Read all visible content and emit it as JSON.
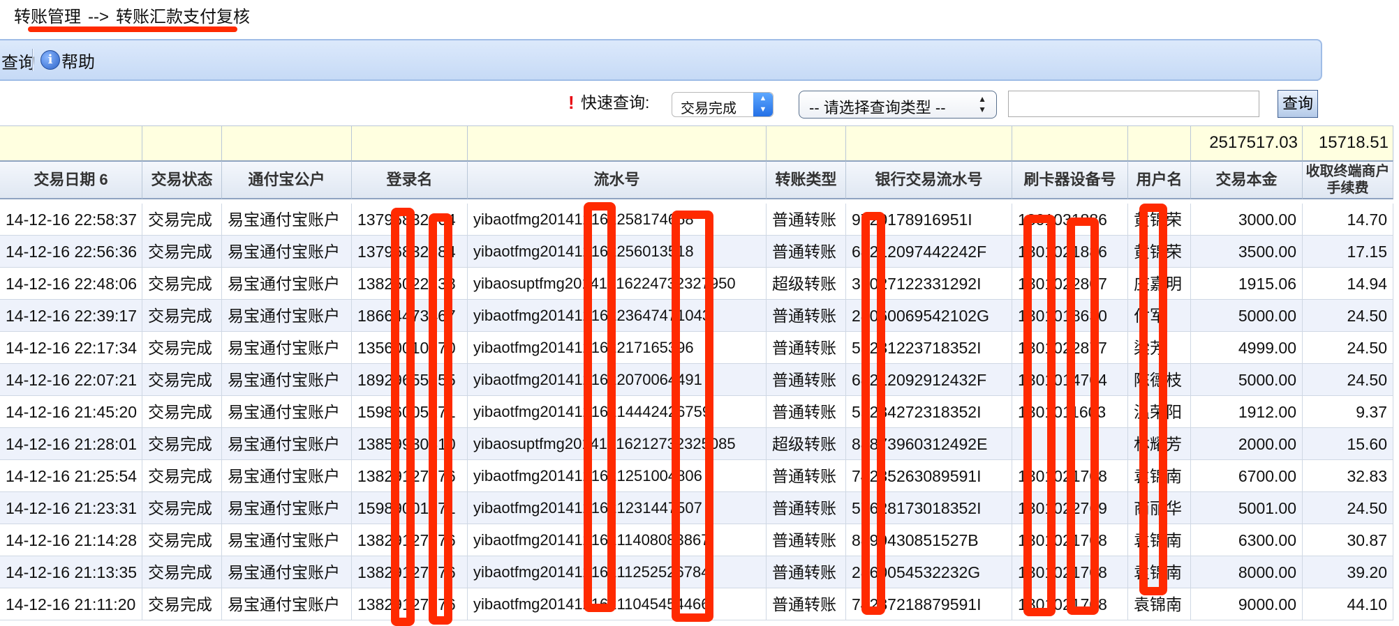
{
  "breadcrumb": {
    "parent": "转账管理",
    "separator": "-->",
    "current": "转账汇款支付复核"
  },
  "toolbar": {
    "query_label": "查询",
    "help_label": "帮助"
  },
  "quick_search": {
    "label": "快速查询:",
    "status_value": "交易完成",
    "type_placeholder": "-- 请选择查询类型 --",
    "input_value": "",
    "button_label": "查询"
  },
  "summary": {
    "principal_total": "2517517.03",
    "fee_total": "15718.51"
  },
  "table": {
    "headers": [
      "交易日期 6",
      "交易状态",
      "通付宝公户",
      "登录名",
      "流水号",
      "转账类型",
      "银行交易流水号",
      "刷卡器设备号",
      "用户名",
      "交易本金",
      "收取终端商户手续费"
    ],
    "rows": [
      [
        "14-12-16 22:58:37",
        "交易完成",
        "易宝通付宝账户",
        "13796832064",
        "yibaotfmg201412162258174658",
        "普通转账",
        "9720178916951I",
        "1301031886",
        "黄锦荣",
        "3000.00",
        "14.70"
      ],
      [
        "14-12-16 22:56:36",
        "交易完成",
        "易宝通付宝账户",
        "13796832384",
        "yibaotfmg201412162256013518",
        "普通转账",
        "6821209744224​2F",
        "1301021886",
        "黄锦荣",
        "3500.00",
        "17.15"
      ],
      [
        "14-12-16 22:48:06",
        "交易完成",
        "易宝通付宝账户",
        "13825022138",
        "yibaosuptfmg201412162247323​27950",
        "超级转账",
        "31027122331292I",
        "1301022807",
        "庄嘉明",
        "1915.06",
        "14.94"
      ],
      [
        "14-12-16 22:39:17",
        "交易完成",
        "易宝通付宝账户",
        "18664473467",
        "yibaotfmg201412162236474710​43",
        "普通转账",
        "28060069542102G",
        "1301018630",
        "付军",
        "5000.00",
        "24.50"
      ],
      [
        "14-12-16 22:17:34",
        "交易完成",
        "易宝通付宝账户",
        "13560010770",
        "yibaotfmg201412162217165396",
        "普通转账",
        "55231223718352I",
        "1301022877",
        "梁芳",
        "4999.00",
        "24.50"
      ],
      [
        "14-12-16 22:07:21",
        "交易完成",
        "易宝通付宝账户",
        "18929655255",
        "yibaotfmg2014121622070​06449​1",
        "普通转账",
        "68212092912432F",
        "1301014704",
        "陈德枝",
        "5000.00",
        "24.50"
      ],
      [
        "14-12-16 21:45:20",
        "交易完成",
        "易宝通付宝账户",
        "15986005171",
        "yibaotfmg2014121621444​2426759",
        "普通转账",
        "55284272318352I",
        "1301011603",
        "温荣阳",
        "1912.00",
        "9.37"
      ],
      [
        "14-12-16 21:28:01",
        "交易完成",
        "易宝通付宝账户",
        "13859930310",
        "yibaosuptfmg2014121621273​2325085",
        "超级转账",
        "88873960312492E",
        "",
        "林耀芳",
        "2000.00",
        "15.60"
      ],
      [
        "14-12-16 21:25:54",
        "交易完成",
        "易宝通付宝账户",
        "13829127776",
        "yibaotfmg2014121621251004806",
        "普通转账",
        "74235263089591I",
        "1301021708",
        "袁锦南",
        "6700.00",
        "32.83"
      ],
      [
        "14-12-16 21:23:31",
        "交易完成",
        "易宝通付宝账户",
        "15989001771",
        "yibaotfmg2014121621231447507",
        "普通转账",
        "57628173018352I",
        "1301022769",
        "商丽华",
        "5001.00",
        "24.50"
      ],
      [
        "14-12-16 21:14:28",
        "交易完成",
        "易宝通付宝账户",
        "13829127776",
        "yibaotfmg2014121621140​8083867",
        "普通转账",
        "8899430851527B",
        "1301021708",
        "袁锦南",
        "6300.00",
        "30.87"
      ],
      [
        "14-12-16 21:13:35",
        "交易完成",
        "易宝通付宝账户",
        "13829127776",
        "yibaotfmg201412162112525267​84",
        "普通转账",
        "28600545322​32G",
        "1301021708",
        "袁锦南",
        "8000.00",
        "39.20"
      ],
      [
        "14-12-16 21:11:20",
        "交易完成",
        "易宝通付宝账户",
        "13829127776",
        "yibaotfmg201412162110454544​66",
        "普通转账",
        "74287218879591I",
        "1301021708",
        "袁锦南",
        "9000.00",
        "44.10"
      ]
    ]
  },
  "annotation_color": "#ff2a00"
}
